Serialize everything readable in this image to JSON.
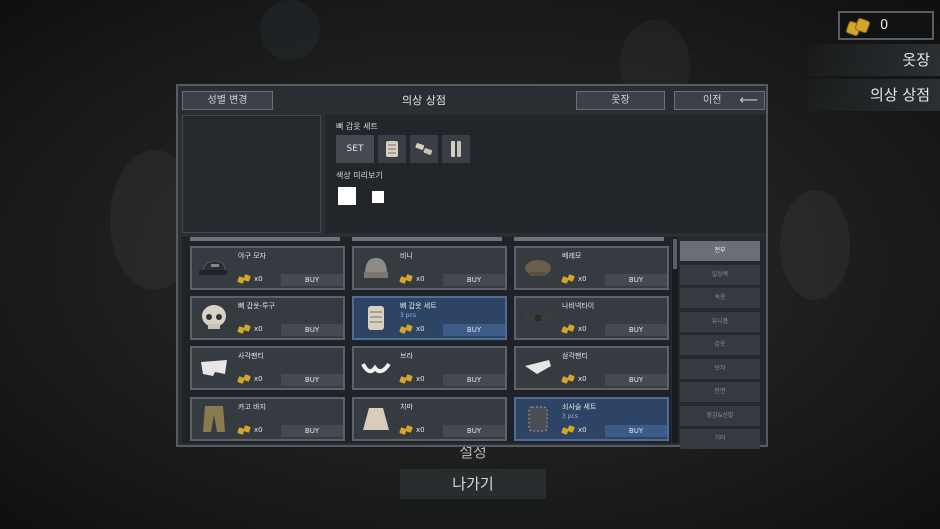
{
  "currency": {
    "icon": "gold-coins-icon",
    "value": "0"
  },
  "side_menu": {
    "wardrobe": "옷장",
    "clothing_store": "의상 상점"
  },
  "bottom_menu": {
    "settings": "설정",
    "exit": "나가기"
  },
  "panel": {
    "title": "의상 상점",
    "gender_change": "성별 변경",
    "wardrobe": "옷장",
    "prev": "이전",
    "set_name": "뼈 갑옷 세트",
    "set_button": "SET",
    "color_preview": "색상 미리보기",
    "color_swatches": [
      "#ffffff",
      "#ffffff"
    ]
  },
  "items": [
    {
      "name": "야구 모자",
      "price": "x0",
      "buy": "BUY",
      "pcs": "",
      "icon": "baseball-cap-icon",
      "selected": false
    },
    {
      "name": "비니",
      "price": "x0",
      "buy": "BUY",
      "pcs": "",
      "icon": "beanie-icon",
      "selected": false
    },
    {
      "name": "베레모",
      "price": "x0",
      "buy": "BUY",
      "pcs": "",
      "icon": "beret-icon",
      "selected": false
    },
    {
      "name": "뼈 갑옷-투구",
      "price": "x0",
      "buy": "BUY",
      "pcs": "",
      "icon": "bone-helmet-icon",
      "selected": false
    },
    {
      "name": "뼈 갑옷 세트",
      "price": "x0",
      "buy": "BUY",
      "pcs": "3 pcs",
      "icon": "bone-armor-icon",
      "selected": true
    },
    {
      "name": "나비넥타이",
      "price": "x0",
      "buy": "BUY",
      "pcs": "",
      "icon": "bow-tie-icon",
      "selected": false
    },
    {
      "name": "사각팬티",
      "price": "x0",
      "buy": "BUY",
      "pcs": "",
      "icon": "boxers-icon",
      "selected": false
    },
    {
      "name": "브라",
      "price": "x0",
      "buy": "BUY",
      "pcs": "",
      "icon": "bra-icon",
      "selected": false
    },
    {
      "name": "삼각팬티",
      "price": "x0",
      "buy": "BUY",
      "pcs": "",
      "icon": "briefs-icon",
      "selected": false
    },
    {
      "name": "카고 바지",
      "price": "x0",
      "buy": "BUY",
      "pcs": "",
      "icon": "cargo-pants-icon",
      "selected": false
    },
    {
      "name": "치마",
      "price": "x0",
      "buy": "BUY",
      "pcs": "",
      "icon": "skirt-icon",
      "selected": false
    },
    {
      "name": "쇠사슬 세트",
      "price": "x0",
      "buy": "BUY",
      "pcs": "3 pcs",
      "icon": "chainmail-icon",
      "selected": true
    }
  ],
  "categories": [
    "전부",
    "일상복",
    "속옷",
    "유니폼",
    "갑옷",
    "모자",
    "안면",
    "장갑&신발",
    "기타"
  ]
}
